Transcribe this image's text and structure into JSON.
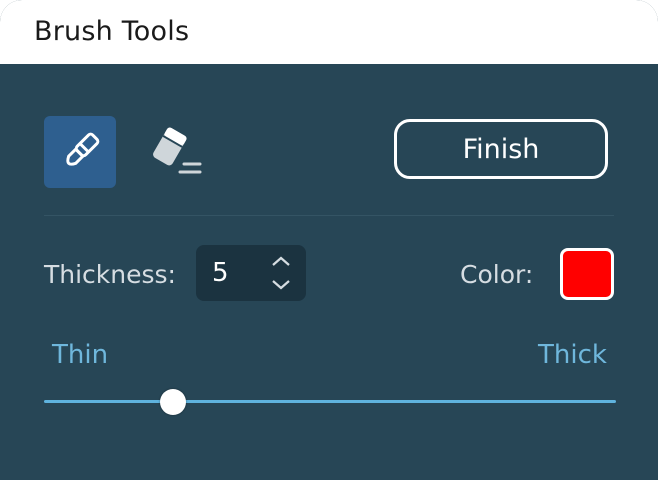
{
  "window": {
    "title": "Brush Tools"
  },
  "tools": [
    {
      "name": "brush",
      "icon": "brush-icon",
      "selected": true
    },
    {
      "name": "eraser",
      "icon": "eraser-icon",
      "selected": false
    }
  ],
  "actions": {
    "finish_label": "Finish"
  },
  "thickness": {
    "label": "Thickness:",
    "value": "5"
  },
  "color": {
    "label": "Color:",
    "value": "#ff0000"
  },
  "slider": {
    "min_label": "Thin",
    "max_label": "Thick",
    "fraction": 0.225
  },
  "colors": {
    "panel_bg": "#274656",
    "selected_tool_bg": "#2e5f8f",
    "slider_accent": "#5fb3de",
    "stepper_bg": "#1b3340"
  }
}
